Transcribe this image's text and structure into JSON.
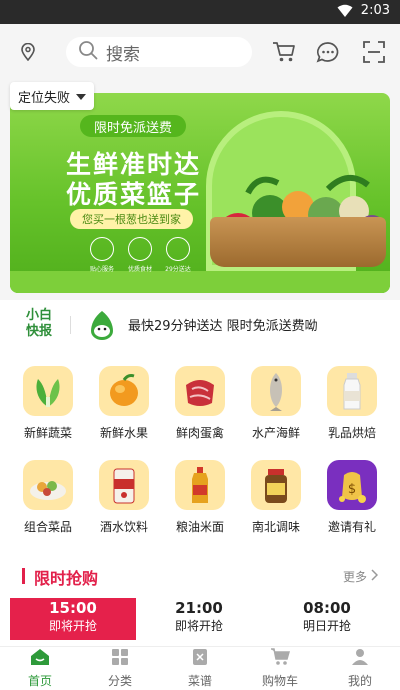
{
  "status_bar": {
    "time": "2:03"
  },
  "header": {
    "search_placeholder": "搜索"
  },
  "location": {
    "label": "定位失败"
  },
  "banner": {
    "tag": "限时免派送费",
    "title_line1": "生鲜准时达",
    "title_line2": "优质菜篮子",
    "pill": "您买一根葱也送到家",
    "features": [
      "贴心服务",
      "优质食材",
      "29分送达"
    ]
  },
  "news": {
    "brand_line1": "小白",
    "brand_line2": "快报",
    "text": "最快29分钟送达  限时免派送费呦"
  },
  "categories": [
    {
      "label": "新鲜蔬菜",
      "icon": "vegetable-icon"
    },
    {
      "label": "新鲜水果",
      "icon": "fruit-icon"
    },
    {
      "label": "鲜肉蛋禽",
      "icon": "meat-icon"
    },
    {
      "label": "水产海鲜",
      "icon": "fish-icon"
    },
    {
      "label": "乳品烘焙",
      "icon": "milk-icon"
    },
    {
      "label": "组合菜品",
      "icon": "dish-icon"
    },
    {
      "label": "酒水饮料",
      "icon": "beer-icon"
    },
    {
      "label": "粮油米面",
      "icon": "oil-icon"
    },
    {
      "label": "南北调味",
      "icon": "sauce-icon"
    },
    {
      "label": "邀请有礼",
      "icon": "gift-bag-icon"
    }
  ],
  "flash_sale": {
    "title": "限时抢购",
    "more": "更多",
    "slots": [
      {
        "time": "15:00",
        "status": "即将开抢",
        "active": true
      },
      {
        "time": "21:00",
        "status": "即将开抢",
        "active": false
      },
      {
        "time": "08:00",
        "status": "明日开抢",
        "active": false
      }
    ]
  },
  "tabs": [
    {
      "label": "首页",
      "icon": "home-icon",
      "active": true
    },
    {
      "label": "分类",
      "icon": "category-icon",
      "active": false
    },
    {
      "label": "菜谱",
      "icon": "recipe-icon",
      "active": false
    },
    {
      "label": "购物车",
      "icon": "cart-icon",
      "active": false
    },
    {
      "label": "我的",
      "icon": "user-icon",
      "active": false
    }
  ],
  "colors": {
    "primary_green": "#2e9a3a",
    "accent_red": "#e2204a",
    "tile_bg": "#ffe7a6"
  }
}
